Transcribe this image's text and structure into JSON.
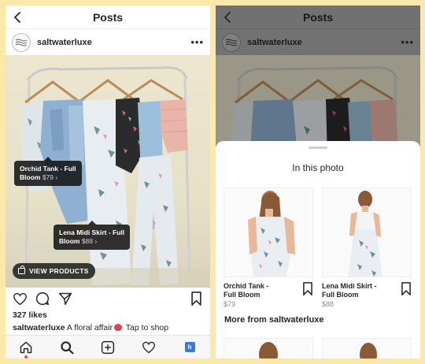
{
  "left": {
    "header": {
      "title": "Posts"
    },
    "account": {
      "username": "saltwaterluxe"
    },
    "tags": [
      {
        "name": "Orchid Tank - Full Bloom",
        "line1": "Orchid Tank - Full",
        "line2": "Bloom",
        "price": "$79 ›"
      },
      {
        "name": "Lena Midi Skirt - Full Bloom",
        "line1": "Lena Midi Skirt - Full",
        "line2": "Bloom",
        "price": "$88 ›"
      }
    ],
    "view_products": "VIEW PRODUCTS",
    "likes": "327 likes",
    "caption": {
      "username": "saltwaterluxe",
      "text": "A floral affair",
      "cta": "Tap to shop"
    }
  },
  "right": {
    "header": {
      "title": "Posts"
    },
    "account": {
      "username": "saltwaterluxe"
    },
    "sheet": {
      "title": "In this photo",
      "products": [
        {
          "line1": "Orchid Tank -",
          "line2": "Full Bloom",
          "price": "$79"
        },
        {
          "line1": "Lena Midi Skirt -",
          "line2": "Full Bloom",
          "price": "$88"
        }
      ],
      "more_title": "More from saltwaterluxe"
    }
  },
  "icons": [
    "back-chevron-icon",
    "more-dots-icon",
    "heart-icon",
    "comment-icon",
    "share-icon",
    "bookmark-icon",
    "home-icon",
    "search-icon",
    "new-post-icon",
    "activity-icon",
    "profile-icon",
    "shopping-bag-icon"
  ],
  "colors": {
    "background": "#FCE9A8",
    "tag_bg": "#141414",
    "notification_dot": "#ed4956",
    "dim_overlay": "#000000"
  }
}
